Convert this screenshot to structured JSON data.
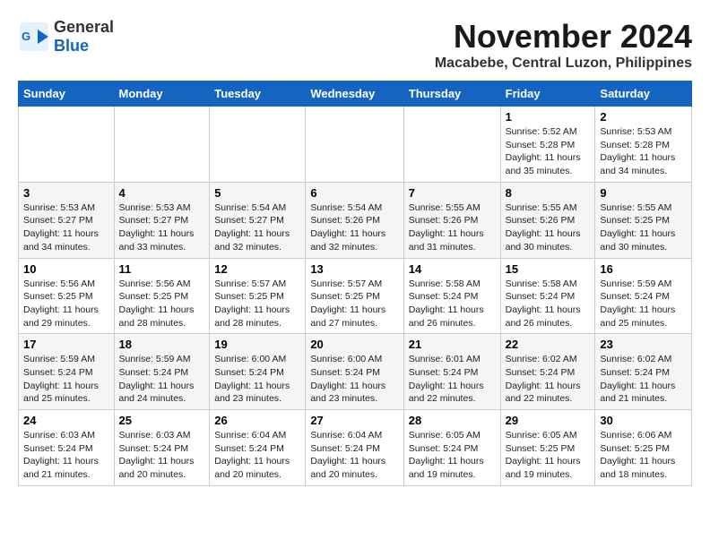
{
  "header": {
    "logo": {
      "general": "General",
      "blue": "Blue"
    },
    "title": "November 2024",
    "subtitle": "Macabebe, Central Luzon, Philippines"
  },
  "columns": [
    "Sunday",
    "Monday",
    "Tuesday",
    "Wednesday",
    "Thursday",
    "Friday",
    "Saturday"
  ],
  "weeks": [
    [
      {
        "day": "",
        "info": ""
      },
      {
        "day": "",
        "info": ""
      },
      {
        "day": "",
        "info": ""
      },
      {
        "day": "",
        "info": ""
      },
      {
        "day": "",
        "info": ""
      },
      {
        "day": "1",
        "info": "Sunrise: 5:52 AM\nSunset: 5:28 PM\nDaylight: 11 hours\nand 35 minutes."
      },
      {
        "day": "2",
        "info": "Sunrise: 5:53 AM\nSunset: 5:28 PM\nDaylight: 11 hours\nand 34 minutes."
      }
    ],
    [
      {
        "day": "3",
        "info": "Sunrise: 5:53 AM\nSunset: 5:27 PM\nDaylight: 11 hours\nand 34 minutes."
      },
      {
        "day": "4",
        "info": "Sunrise: 5:53 AM\nSunset: 5:27 PM\nDaylight: 11 hours\nand 33 minutes."
      },
      {
        "day": "5",
        "info": "Sunrise: 5:54 AM\nSunset: 5:27 PM\nDaylight: 11 hours\nand 32 minutes."
      },
      {
        "day": "6",
        "info": "Sunrise: 5:54 AM\nSunset: 5:26 PM\nDaylight: 11 hours\nand 32 minutes."
      },
      {
        "day": "7",
        "info": "Sunrise: 5:55 AM\nSunset: 5:26 PM\nDaylight: 11 hours\nand 31 minutes."
      },
      {
        "day": "8",
        "info": "Sunrise: 5:55 AM\nSunset: 5:26 PM\nDaylight: 11 hours\nand 30 minutes."
      },
      {
        "day": "9",
        "info": "Sunrise: 5:55 AM\nSunset: 5:25 PM\nDaylight: 11 hours\nand 30 minutes."
      }
    ],
    [
      {
        "day": "10",
        "info": "Sunrise: 5:56 AM\nSunset: 5:25 PM\nDaylight: 11 hours\nand 29 minutes."
      },
      {
        "day": "11",
        "info": "Sunrise: 5:56 AM\nSunset: 5:25 PM\nDaylight: 11 hours\nand 28 minutes."
      },
      {
        "day": "12",
        "info": "Sunrise: 5:57 AM\nSunset: 5:25 PM\nDaylight: 11 hours\nand 28 minutes."
      },
      {
        "day": "13",
        "info": "Sunrise: 5:57 AM\nSunset: 5:25 PM\nDaylight: 11 hours\nand 27 minutes."
      },
      {
        "day": "14",
        "info": "Sunrise: 5:58 AM\nSunset: 5:24 PM\nDaylight: 11 hours\nand 26 minutes."
      },
      {
        "day": "15",
        "info": "Sunrise: 5:58 AM\nSunset: 5:24 PM\nDaylight: 11 hours\nand 26 minutes."
      },
      {
        "day": "16",
        "info": "Sunrise: 5:59 AM\nSunset: 5:24 PM\nDaylight: 11 hours\nand 25 minutes."
      }
    ],
    [
      {
        "day": "17",
        "info": "Sunrise: 5:59 AM\nSunset: 5:24 PM\nDaylight: 11 hours\nand 25 minutes."
      },
      {
        "day": "18",
        "info": "Sunrise: 5:59 AM\nSunset: 5:24 PM\nDaylight: 11 hours\nand 24 minutes."
      },
      {
        "day": "19",
        "info": "Sunrise: 6:00 AM\nSunset: 5:24 PM\nDaylight: 11 hours\nand 23 minutes."
      },
      {
        "day": "20",
        "info": "Sunrise: 6:00 AM\nSunset: 5:24 PM\nDaylight: 11 hours\nand 23 minutes."
      },
      {
        "day": "21",
        "info": "Sunrise: 6:01 AM\nSunset: 5:24 PM\nDaylight: 11 hours\nand 22 minutes."
      },
      {
        "day": "22",
        "info": "Sunrise: 6:02 AM\nSunset: 5:24 PM\nDaylight: 11 hours\nand 22 minutes."
      },
      {
        "day": "23",
        "info": "Sunrise: 6:02 AM\nSunset: 5:24 PM\nDaylight: 11 hours\nand 21 minutes."
      }
    ],
    [
      {
        "day": "24",
        "info": "Sunrise: 6:03 AM\nSunset: 5:24 PM\nDaylight: 11 hours\nand 21 minutes."
      },
      {
        "day": "25",
        "info": "Sunrise: 6:03 AM\nSunset: 5:24 PM\nDaylight: 11 hours\nand 20 minutes."
      },
      {
        "day": "26",
        "info": "Sunrise: 6:04 AM\nSunset: 5:24 PM\nDaylight: 11 hours\nand 20 minutes."
      },
      {
        "day": "27",
        "info": "Sunrise: 6:04 AM\nSunset: 5:24 PM\nDaylight: 11 hours\nand 20 minutes."
      },
      {
        "day": "28",
        "info": "Sunrise: 6:05 AM\nSunset: 5:24 PM\nDaylight: 11 hours\nand 19 minutes."
      },
      {
        "day": "29",
        "info": "Sunrise: 6:05 AM\nSunset: 5:25 PM\nDaylight: 11 hours\nand 19 minutes."
      },
      {
        "day": "30",
        "info": "Sunrise: 6:06 AM\nSunset: 5:25 PM\nDaylight: 11 hours\nand 18 minutes."
      }
    ]
  ]
}
